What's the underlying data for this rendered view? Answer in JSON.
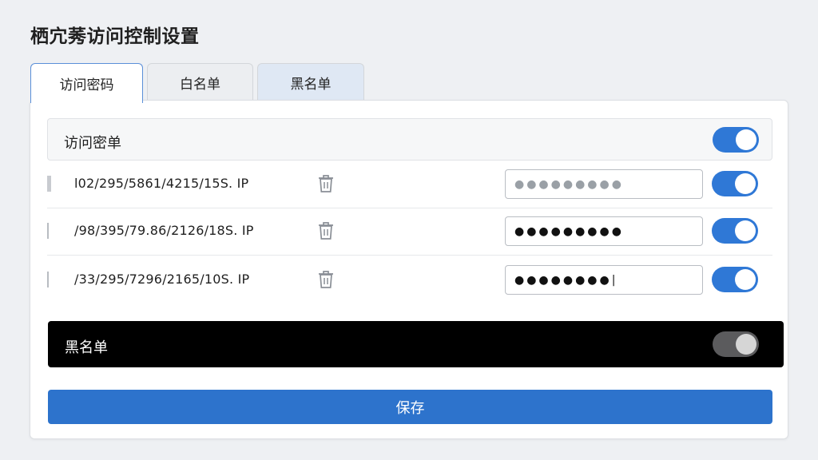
{
  "page": {
    "title": "栖宂莠访问控制设置"
  },
  "tabs": [
    {
      "label": "访问密码",
      "active": true
    },
    {
      "label": "白名单",
      "active": false
    },
    {
      "label": "黑名单",
      "active": false
    }
  ],
  "access_password": {
    "title": "访问密单",
    "enabled": true,
    "rows": [
      {
        "ip": "l02/295/5861/4215/15S. IP",
        "password": "●●●●●●●●●",
        "enabled": true
      },
      {
        "ip": "/98/395/79.86/2126/18S. IP",
        "password": "●●●●●●●●●",
        "enabled": true
      },
      {
        "ip": "/33/295/7296/2165/10S. IP",
        "password": "●●●●●●●●|",
        "enabled": true
      }
    ]
  },
  "blacklist": {
    "title": "黑名单",
    "enabled": false
  },
  "actions": {
    "save_label": "保存"
  },
  "colors": {
    "accent": "#2f78d6",
    "button": "#2d73cc",
    "toggle_off": "#5b5b5d"
  }
}
